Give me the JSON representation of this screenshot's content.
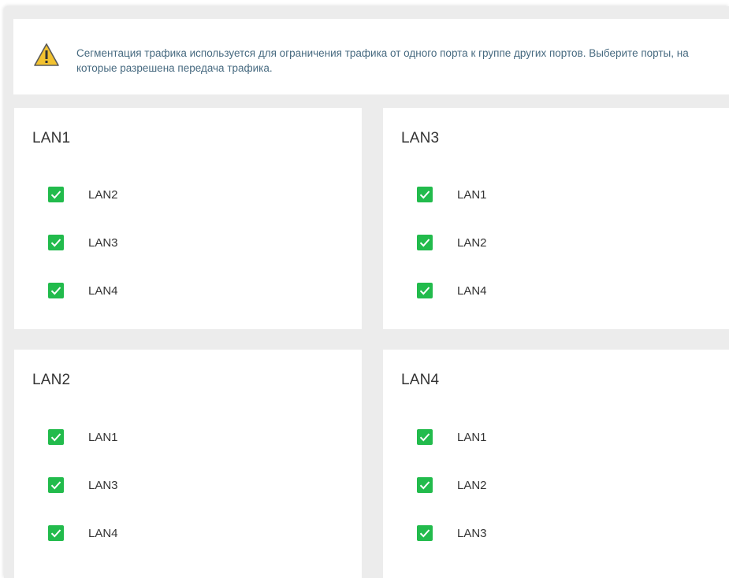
{
  "notice": {
    "icon": "warning-icon",
    "text": "Сегментация трафика используется для ограничения трафика от одного порта к группе других портов. Выберите порты, на которые разрешена передача трафика."
  },
  "colors": {
    "checkbox": "#22bb4c",
    "notice_text": "#476a80",
    "background": "#ececec",
    "warning": "#f2c230"
  },
  "ports": [
    {
      "title": "LAN1",
      "targets": [
        {
          "label": "LAN2",
          "checked": true
        },
        {
          "label": "LAN3",
          "checked": true
        },
        {
          "label": "LAN4",
          "checked": true
        }
      ]
    },
    {
      "title": "LAN3",
      "targets": [
        {
          "label": "LAN1",
          "checked": true
        },
        {
          "label": "LAN2",
          "checked": true
        },
        {
          "label": "LAN4",
          "checked": true
        }
      ]
    },
    {
      "title": "LAN2",
      "targets": [
        {
          "label": "LAN1",
          "checked": true
        },
        {
          "label": "LAN3",
          "checked": true
        },
        {
          "label": "LAN4",
          "checked": true
        }
      ]
    },
    {
      "title": "LAN4",
      "targets": [
        {
          "label": "LAN1",
          "checked": true
        },
        {
          "label": "LAN2",
          "checked": true
        },
        {
          "label": "LAN3",
          "checked": true
        }
      ]
    }
  ]
}
